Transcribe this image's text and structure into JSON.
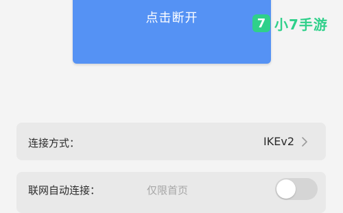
{
  "actions": {
    "disconnect_label": "点击断开"
  },
  "watermark": {
    "logo_char": "7",
    "text": "小7手游",
    "color": "#2fd08a"
  },
  "settings": {
    "connection_method": {
      "label": "连接方式：",
      "value": "IKEv2",
      "icon": "chevron-right-icon"
    },
    "auto_connect": {
      "label": "联网自动连接：",
      "hint": "仅限首页",
      "enabled": false
    }
  },
  "colors": {
    "primary_button": "#5592f4",
    "card_background": "#e9e9e9",
    "page_background": "#f4f4f4"
  }
}
